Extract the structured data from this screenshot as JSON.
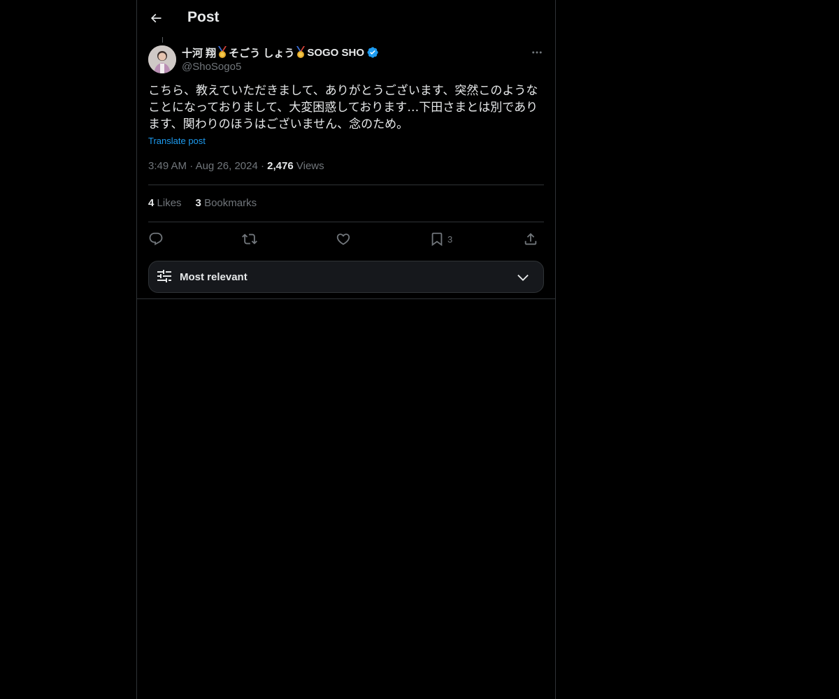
{
  "header": {
    "title": "Post"
  },
  "author": {
    "name_part1": "十河 翔",
    "name_part2": "そごう しょう",
    "name_part3": "SOGO SHO",
    "handle": "@ShoSogo5"
  },
  "post": {
    "text": "こちら、教えていただきまして、ありがとうございます、突然このようなことになっておりまして、大変困惑しております…下田さまとは別であります、関わりのほうはございません、念のため。",
    "translate_label": "Translate post",
    "time": "3:49 AM",
    "date": "Aug 26, 2024",
    "views_count": "2,476",
    "views_label": "Views"
  },
  "stats": {
    "likes_count": "4",
    "likes_label": "Likes",
    "bookmarks_count": "3",
    "bookmarks_label": "Bookmarks"
  },
  "actions": {
    "bookmark_count": "3"
  },
  "sort": {
    "label": "Most relevant"
  },
  "colors": {
    "background": "#000000",
    "accent": "#1d9bf0",
    "muted": "#71767b",
    "border": "#2f3336"
  }
}
